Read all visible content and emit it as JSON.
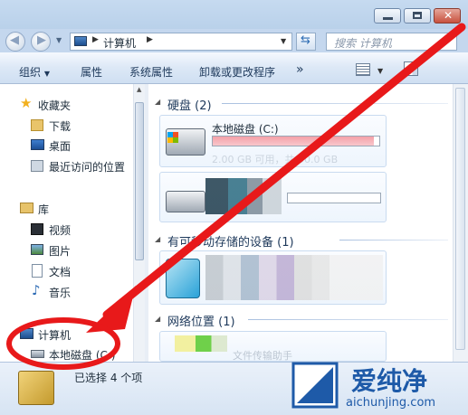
{
  "window": {
    "minimize_icon": "minimize-icon",
    "maximize_icon": "maximize-icon",
    "close_icon": "close-icon"
  },
  "address": {
    "path_root": "计算机",
    "search_placeholder": "搜索 计算机"
  },
  "toolbar": {
    "organize": "组织",
    "properties": "属性",
    "system_properties": "系统属性",
    "uninstall": "卸载或更改程序",
    "more": "»"
  },
  "sidebar": {
    "favorites": {
      "label": "收藏夹",
      "items": [
        "下载",
        "桌面",
        "最近访问的位置"
      ]
    },
    "libraries": {
      "label": "库",
      "items": [
        "视频",
        "图片",
        "文档",
        "音乐"
      ]
    },
    "computer": {
      "label": "计算机",
      "items": [
        "本地磁盘 (C:)"
      ]
    }
  },
  "content": {
    "hard_disks": {
      "header": "硬盘 (2)",
      "drive_c": "本地磁盘 (C:)",
      "drive_c_size": "2.00 GB 可用，共 50.0 GB",
      "drive_c_fill": 0.97
    },
    "removable": {
      "header": "有可移动存储的设备 (1)"
    },
    "network": {
      "header": "网络位置 (1)",
      "item_text": "文件传输助手"
    }
  },
  "status": {
    "selected_text": "已选择 4 个项"
  },
  "watermark": {
    "brand": "爱纯净",
    "url": "aichunjing.com"
  },
  "colors": {
    "annotation_red": "#e8191a",
    "accent": "#1e395b"
  }
}
